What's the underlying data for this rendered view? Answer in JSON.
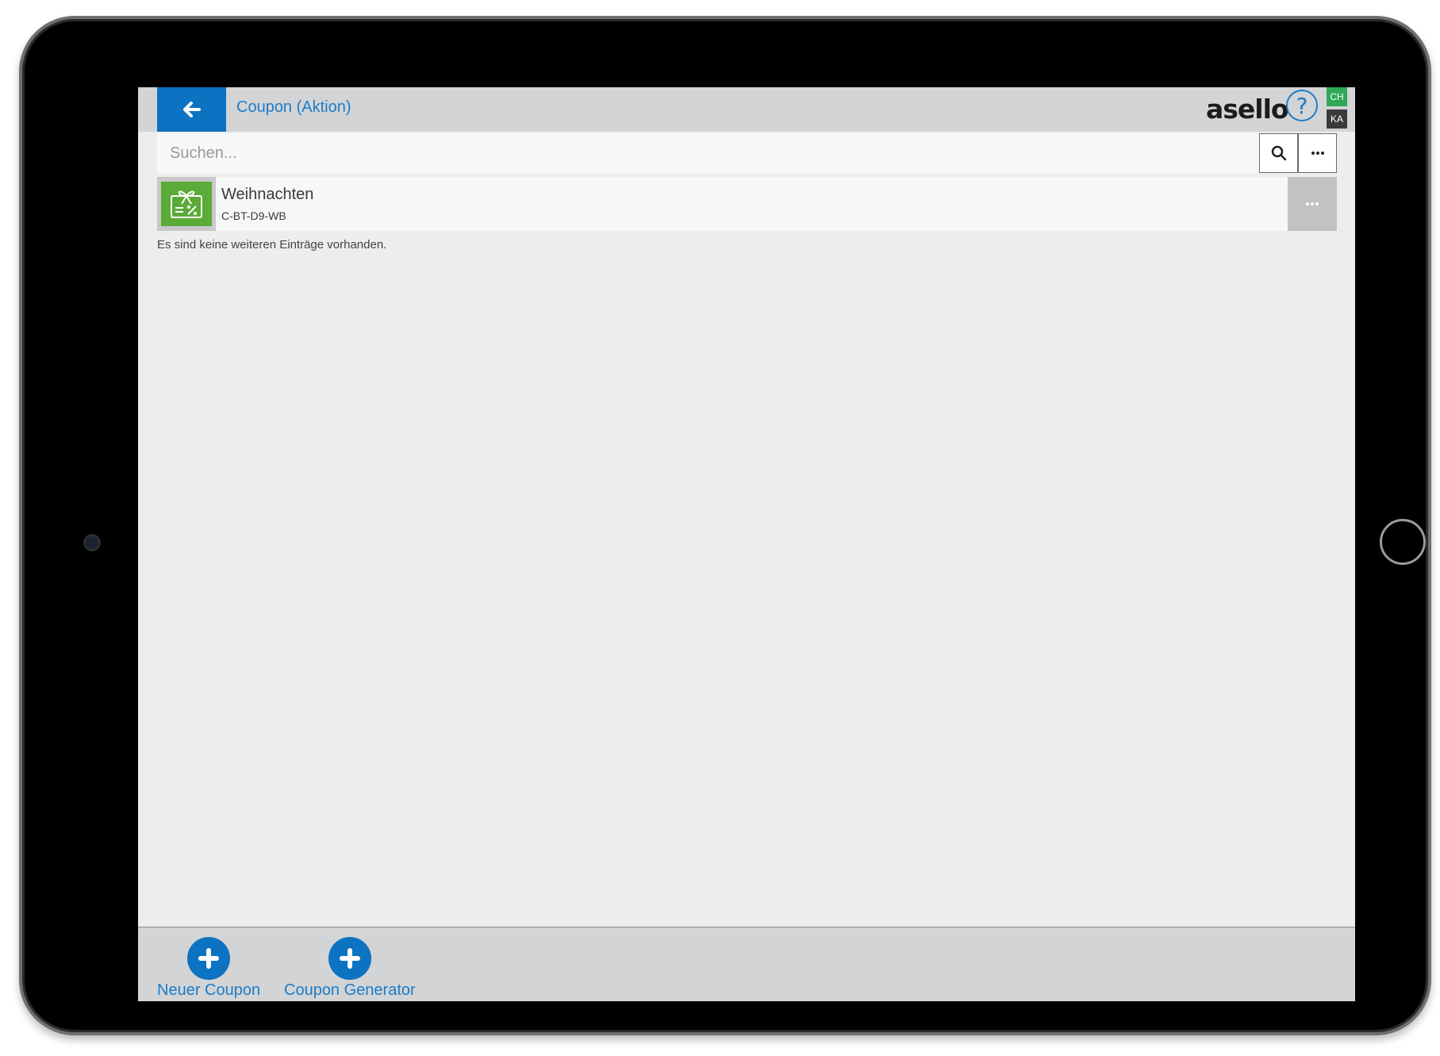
{
  "header": {
    "title": "Coupon (Aktion)",
    "logo_text": "asello",
    "help_symbol": "?",
    "badge_top": "CH",
    "badge_bottom": "KA",
    "accent_color": "#0c73c3"
  },
  "icons": {
    "back": "arrow-left-icon",
    "help": "question-circle-icon",
    "search": "magnifier-icon",
    "more": "ellipsis-icon",
    "coupon": "gift-voucher-percent-icon",
    "add": "plus-circle-icon"
  },
  "search": {
    "placeholder": "Suchen..."
  },
  "list": {
    "items": [
      {
        "title": "Weihnachten",
        "code": "C-BT-D9-WB",
        "thumb_color": "#5aab37"
      }
    ],
    "empty_note": "Es sind keine weiteren Einträge vorhanden."
  },
  "footer": {
    "actions": [
      {
        "label": "Neuer Coupon"
      },
      {
        "label": "Coupon Generator"
      }
    ]
  }
}
